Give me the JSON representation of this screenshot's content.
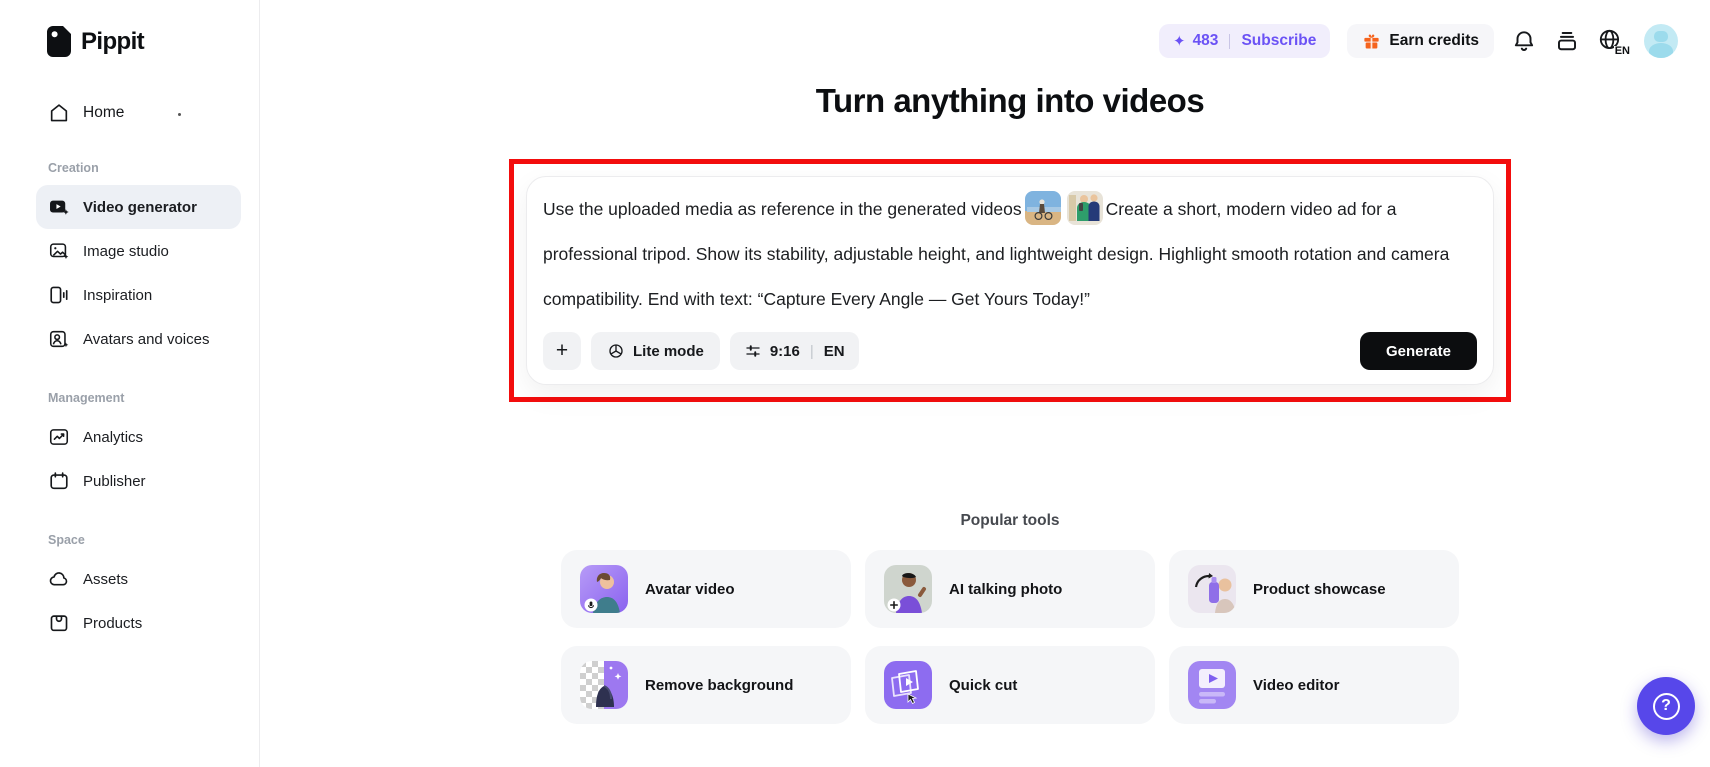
{
  "brand": {
    "name": "Pippit"
  },
  "sidebar": {
    "home_label": "Home",
    "sections": [
      {
        "label": "Creation",
        "items": [
          {
            "label": "Video generator",
            "icon": "video-generator-icon",
            "active": true
          },
          {
            "label": "Image studio",
            "icon": "image-studio-icon"
          },
          {
            "label": "Inspiration",
            "icon": "inspiration-icon"
          },
          {
            "label": "Avatars and voices",
            "icon": "avatars-voices-icon"
          }
        ]
      },
      {
        "label": "Management",
        "items": [
          {
            "label": "Analytics",
            "icon": "analytics-icon"
          },
          {
            "label": "Publisher",
            "icon": "publisher-icon"
          }
        ]
      },
      {
        "label": "Space",
        "items": [
          {
            "label": "Assets",
            "icon": "assets-cloud-icon"
          },
          {
            "label": "Products",
            "icon": "products-box-icon"
          }
        ]
      }
    ]
  },
  "header": {
    "credits": "483",
    "credits_star_icon": "sparkle-star-icon",
    "subscribe_label": "Subscribe",
    "earn_credits_label": "Earn credits",
    "language_badge": "EN"
  },
  "hero": {
    "title": "Turn anything into videos"
  },
  "composer": {
    "prompt_before_images": "Use the uploaded media as reference in the generated videos",
    "prompt_after_images": "Create a short, modern video ad for a professional tripod. Show its stability, adjustable height, and lightweight design. Highlight smooth rotation and camera compatibility. End with text: “Capture Every Angle — Get Yours Today!”",
    "attachments": [
      {
        "name": "beach-bike-photo-thumbnail"
      },
      {
        "name": "family-photo-thumbnail"
      }
    ],
    "add_button_label": "+",
    "lite_mode_label": "Lite mode",
    "aspect_ratio": "9:16",
    "language": "EN",
    "generate_label": "Generate"
  },
  "popular_tools": {
    "title": "Popular tools",
    "tools": [
      {
        "label": "Avatar video"
      },
      {
        "label": "AI talking photo"
      },
      {
        "label": "Product showcase"
      },
      {
        "label": "Remove background"
      },
      {
        "label": "Quick cut"
      },
      {
        "label": "Video editor"
      }
    ]
  },
  "fab": {
    "help_label": "?"
  },
  "colors": {
    "accent_purple": "#6b52f5",
    "annotation_red": "#f30d0d",
    "generate_black": "#0c0d0f",
    "help_fab_purple": "#5747ea",
    "gift_orange": "#f5631d",
    "avatar_cyan": "#c3eaf4",
    "selected_item_bg": "#edf0f5",
    "tool_card_bg": "#f5f6f8"
  }
}
